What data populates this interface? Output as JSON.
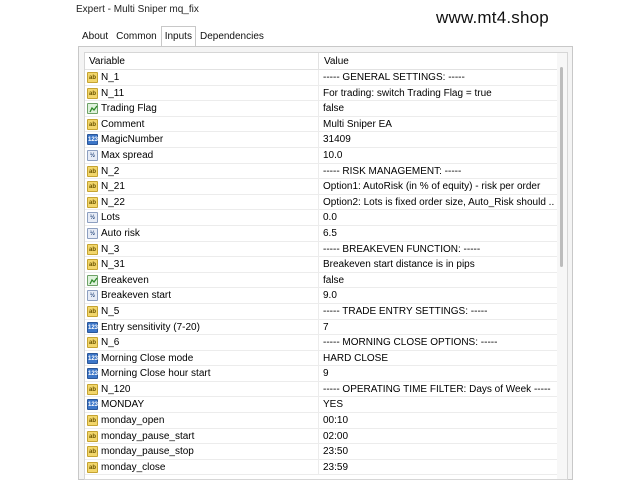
{
  "window": {
    "title": "Expert - Multi Sniper mq_fix",
    "watermark": "www.mt4.shop"
  },
  "tabs": [
    {
      "label": "About"
    },
    {
      "label": "Common"
    },
    {
      "label": "Inputs"
    },
    {
      "label": "Dependencies"
    }
  ],
  "active_tab": "Inputs",
  "columns": {
    "variable": "Variable",
    "value": "Value"
  },
  "rows": [
    {
      "icon": "ab",
      "name": "N_1",
      "value": "----- GENERAL SETTINGS: -----"
    },
    {
      "icon": "ab",
      "name": "N_11",
      "value": "For trading: switch Trading Flag = true"
    },
    {
      "icon": "flag",
      "name": "Trading Flag",
      "value": "false"
    },
    {
      "icon": "ab",
      "name": "Comment",
      "value": " Multi Sniper EA"
    },
    {
      "icon": "num",
      "name": "MagicNumber",
      "value": "31409"
    },
    {
      "icon": "flt",
      "name": "Max spread",
      "value": "10.0"
    },
    {
      "icon": "ab",
      "name": "N_2",
      "value": "----- RISK MANAGEMENT: -----"
    },
    {
      "icon": "ab",
      "name": "N_21",
      "value": "Option1: AutoRisk (in % of equity) - risk per order"
    },
    {
      "icon": "ab",
      "name": "N_22",
      "value": "Option2: Lots is fixed order size, Auto_Risk should ..."
    },
    {
      "icon": "flt",
      "name": "Lots",
      "value": "0.0"
    },
    {
      "icon": "flt",
      "name": "Auto risk",
      "value": "6.5"
    },
    {
      "icon": "ab",
      "name": "N_3",
      "value": "-----   BREAKEVEN FUNCTION: -----"
    },
    {
      "icon": "ab",
      "name": "N_31",
      "value": "Breakeven start distance is in pips"
    },
    {
      "icon": "flag",
      "name": "Breakeven",
      "value": "false"
    },
    {
      "icon": "flt",
      "name": "Breakeven start",
      "value": "9.0"
    },
    {
      "icon": "ab",
      "name": "N_5",
      "value": "----- TRADE ENTRY SETTINGS: -----"
    },
    {
      "icon": "num",
      "name": "Entry sensitivity (7-20)",
      "value": "7"
    },
    {
      "icon": "ab",
      "name": "N_6",
      "value": "----- MORNING CLOSE OPTIONS: -----"
    },
    {
      "icon": "num",
      "name": "Morning Close mode",
      "value": "HARD CLOSE"
    },
    {
      "icon": "num",
      "name": "Morning Close hour start",
      "value": "9"
    },
    {
      "icon": "ab",
      "name": "N_120",
      "value": "----- OPERATING TIME FILTER: Days of Week -----"
    },
    {
      "icon": "num",
      "name": "MONDAY",
      "value": "YES"
    },
    {
      "icon": "ab",
      "name": "monday_open",
      "value": "00:10"
    },
    {
      "icon": "ab",
      "name": "monday_pause_start",
      "value": "02:00"
    },
    {
      "icon": "ab",
      "name": "monday_pause_stop",
      "value": "23:50"
    },
    {
      "icon": "ab",
      "name": "monday_close",
      "value": "23:59"
    }
  ]
}
